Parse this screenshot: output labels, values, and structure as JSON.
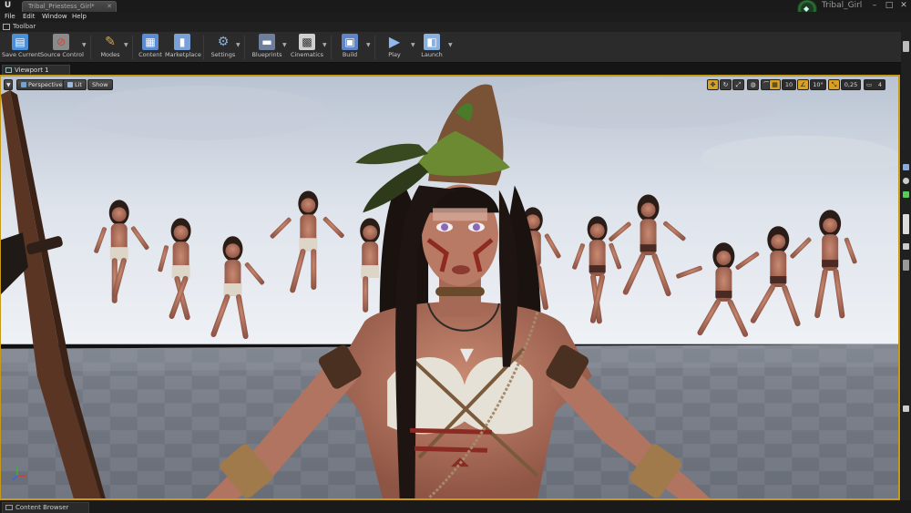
{
  "titlebar": {
    "doc_tab": "Tribal_Priestess_Girl*",
    "project_name": "Tribal_Girl",
    "controls": [
      "–",
      "□",
      "✕"
    ]
  },
  "menu": [
    "File",
    "Edit",
    "Window",
    "Help"
  ],
  "toolbar_panel": {
    "title": "Toolbar"
  },
  "toolbar": [
    {
      "label": "Save Current",
      "icon": "save-icon",
      "color": "#4a8fd8"
    },
    {
      "label": "Source Control",
      "icon": "source-control-icon",
      "color": "#c84a3a"
    },
    {
      "label": "Modes",
      "icon": "modes-icon",
      "color": "#d6a84a"
    },
    {
      "label": "Content",
      "icon": "content-icon",
      "color": "#5b8bd0"
    },
    {
      "label": "Marketplace",
      "icon": "marketplace-icon",
      "color": "#7aa0d8"
    },
    {
      "label": "Settings",
      "icon": "settings-gear-icon",
      "color": "#6f8fb8"
    },
    {
      "label": "Blueprints",
      "icon": "blueprints-icon",
      "color": "#7d9ac8"
    },
    {
      "label": "Cinematics",
      "icon": "cinematics-icon",
      "color": "#c8c8c8"
    },
    {
      "label": "Build",
      "icon": "build-icon",
      "color": "#5f84c8"
    },
    {
      "label": "Play",
      "icon": "play-icon",
      "color": "#6f9ee0"
    },
    {
      "label": "Launch",
      "icon": "launch-icon",
      "color": "#8ab0e0"
    }
  ],
  "viewport": {
    "tab_label": "Viewport 1",
    "view_mode": "Perspective",
    "lighting": "Lit",
    "show": "Show",
    "grid_snap": "10",
    "rotation_snap": "10°",
    "scale_snap": "0,25",
    "camera_speed": "4"
  },
  "bottom": {
    "content_browser": "Content Browser"
  },
  "colors": {
    "selection_border": "#c49a18",
    "accent": "#d8a020"
  }
}
